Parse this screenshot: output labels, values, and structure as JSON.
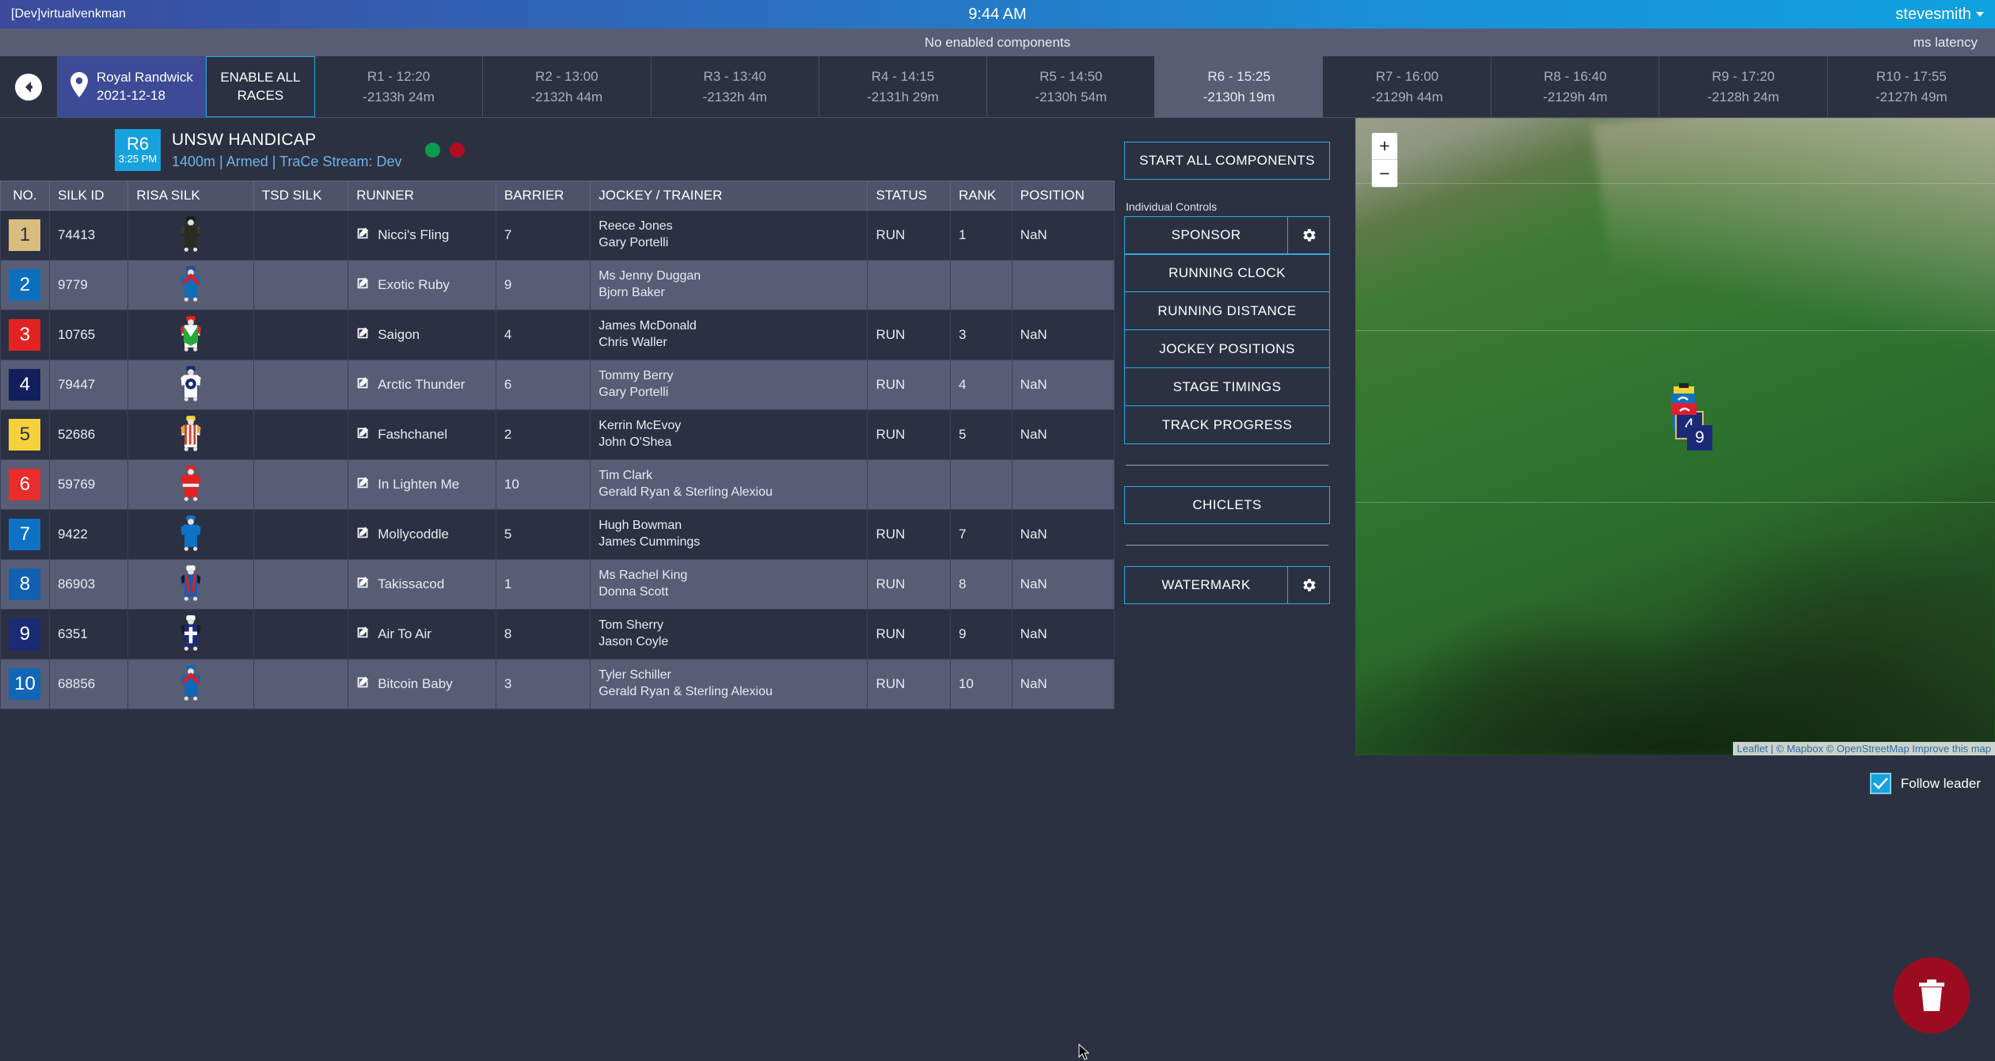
{
  "topbar": {
    "brand": "[Dev]virtualvenkman",
    "clock": "9:44 AM",
    "user": "stevesmith"
  },
  "statusbar": {
    "center_message": "No enabled components",
    "latency": "ms latency"
  },
  "racebar": {
    "back_icon": "back-arrow-icon",
    "venue": {
      "pin_icon": "map-pin-icon",
      "name": "Royal Randwick",
      "date": "2021-12-18"
    },
    "enable_all_label": "ENABLE ALL RACES",
    "tabs": [
      {
        "label": "R1 - 12:20",
        "countdown": "-2133h 24m",
        "active": false
      },
      {
        "label": "R2 - 13:00",
        "countdown": "-2132h 44m",
        "active": false
      },
      {
        "label": "R3 - 13:40",
        "countdown": "-2132h 4m",
        "active": false
      },
      {
        "label": "R4 - 14:15",
        "countdown": "-2131h 29m",
        "active": false
      },
      {
        "label": "R5 - 14:50",
        "countdown": "-2130h 54m",
        "active": false
      },
      {
        "label": "R6 - 15:25",
        "countdown": "-2130h 19m",
        "active": true
      },
      {
        "label": "R7 - 16:00",
        "countdown": "-2129h 44m",
        "active": false
      },
      {
        "label": "R8 - 16:40",
        "countdown": "-2129h 4m",
        "active": false
      },
      {
        "label": "R9 - 17:20",
        "countdown": "-2128h 24m",
        "active": false
      },
      {
        "label": "R10 - 17:55",
        "countdown": "-2127h 49m",
        "active": false
      }
    ]
  },
  "race_header": {
    "badge_race": "R6",
    "badge_time": "3:25 PM",
    "title": "UNSW HANDICAP",
    "subtitle": "1400m | Armed | TraCe Stream: Dev",
    "led_green": "#0a9c4a",
    "led_red": "#b00d22"
  },
  "table": {
    "columns": [
      "NO.",
      "SILK ID",
      "RISA SILK",
      "TSD SILK",
      "RUNNER",
      "BARRIER",
      "JOCKEY / TRAINER",
      "STATUS",
      "RANK",
      "POSITION"
    ],
    "rows": [
      {
        "no": "1",
        "no_bg": "#d9bd7f",
        "no_fg": "#2b3043",
        "silk_id": "74413",
        "runner": "Nicci's Fling",
        "barrier": "7",
        "jockey": "Reece Jones",
        "trainer": "Gary Portelli",
        "status": "RUN",
        "rank": "1",
        "position": "NaN",
        "edit_icon": "edit-pencil-icon"
      },
      {
        "no": "2",
        "no_bg": "#0b6fbe",
        "no_fg": "#ffffff",
        "silk_id": "9779",
        "runner": "Exotic Ruby",
        "barrier": "9",
        "jockey": "Ms Jenny Duggan",
        "trainer": "Bjorn Baker",
        "status": "",
        "rank": "",
        "position": "",
        "edit_icon": "edit-pencil-icon"
      },
      {
        "no": "3",
        "no_bg": "#e32222",
        "no_fg": "#ffffff",
        "silk_id": "10765",
        "runner": "Saigon",
        "barrier": "4",
        "jockey": "James McDonald",
        "trainer": "Chris Waller",
        "status": "RUN",
        "rank": "3",
        "position": "NaN",
        "edit_icon": "edit-pencil-icon"
      },
      {
        "no": "4",
        "no_bg": "#121f5c",
        "no_fg": "#ffffff",
        "silk_id": "79447",
        "runner": "Arctic Thunder",
        "barrier": "6",
        "jockey": "Tommy Berry",
        "trainer": "Gary Portelli",
        "status": "RUN",
        "rank": "4",
        "position": "NaN",
        "edit_icon": "edit-pencil-icon"
      },
      {
        "no": "5",
        "no_bg": "#f5d23c",
        "no_fg": "#2b3043",
        "silk_id": "52686",
        "runner": "Fashchanel",
        "barrier": "2",
        "jockey": "Kerrin McEvoy",
        "trainer": "John O'Shea",
        "status": "RUN",
        "rank": "5",
        "position": "NaN",
        "edit_icon": "edit-pencil-icon"
      },
      {
        "no": "6",
        "no_bg": "#e92c2c",
        "no_fg": "#ffffff",
        "silk_id": "59769",
        "runner": "In Lighten Me",
        "barrier": "10",
        "jockey": "Tim Clark",
        "trainer": "Gerald Ryan & Sterling Alexiou",
        "status": "",
        "rank": "",
        "position": "",
        "edit_icon": "edit-pencil-icon"
      },
      {
        "no": "7",
        "no_bg": "#0d72c4",
        "no_fg": "#ffffff",
        "silk_id": "9422",
        "runner": "Mollycoddle",
        "barrier": "5",
        "jockey": "Hugh Bowman",
        "trainer": "James Cummings",
        "status": "RUN",
        "rank": "7",
        "position": "NaN",
        "edit_icon": "edit-pencil-icon"
      },
      {
        "no": "8",
        "no_bg": "#1161b0",
        "no_fg": "#ffffff",
        "silk_id": "86903",
        "runner": "Takissacod",
        "barrier": "1",
        "jockey": "Ms Rachel King",
        "trainer": "Donna Scott",
        "status": "RUN",
        "rank": "8",
        "position": "NaN",
        "edit_icon": "edit-pencil-icon"
      },
      {
        "no": "9",
        "no_bg": "#1b2a77",
        "no_fg": "#ffffff",
        "silk_id": "6351",
        "runner": "Air To Air",
        "barrier": "8",
        "jockey": "Tom Sherry",
        "trainer": "Jason Coyle",
        "status": "RUN",
        "rank": "9",
        "position": "NaN",
        "edit_icon": "edit-pencil-icon"
      },
      {
        "no": "10",
        "no_bg": "#1266b7",
        "no_fg": "#ffffff",
        "silk_id": "68856",
        "runner": "Bitcoin Baby",
        "barrier": "3",
        "jockey": "Tyler Schiller",
        "trainer": "Gerald Ryan & Sterling Alexiou",
        "status": "RUN",
        "rank": "10",
        "position": "NaN",
        "edit_icon": "edit-pencil-icon"
      }
    ]
  },
  "controls": {
    "start_all_label": "START ALL COMPONENTS",
    "individual_label": "Individual Controls",
    "sponsor_label": "SPONSOR",
    "running_clock_label": "RUNNING CLOCK",
    "running_distance_label": "RUNNING DISTANCE",
    "jockey_positions_label": "JOCKEY POSITIONS",
    "stage_timings_label": "STAGE TIMINGS",
    "track_progress_label": "TRACK PROGRESS",
    "chiclets_label": "CHICLETS",
    "watermark_label": "WATERMARK",
    "gear_icon": "gear-icon",
    "accent": "#29abe2"
  },
  "map": {
    "zoom_in": "+",
    "zoom_out": "−",
    "attribution": "Leaflet | © Mapbox © OpenStreetMap Improve this map",
    "follow_leader_label": "Follow leader",
    "follow_leader_checked": true,
    "markers": [
      {
        "label": "4",
        "bg": "#1b2a77",
        "border": "#d9bd7f"
      },
      {
        "label": "9",
        "bg": "#1b2a77",
        "border": "#1b2a77"
      }
    ]
  },
  "fab": {
    "icon": "trash-icon",
    "color": "#9c0c20"
  }
}
